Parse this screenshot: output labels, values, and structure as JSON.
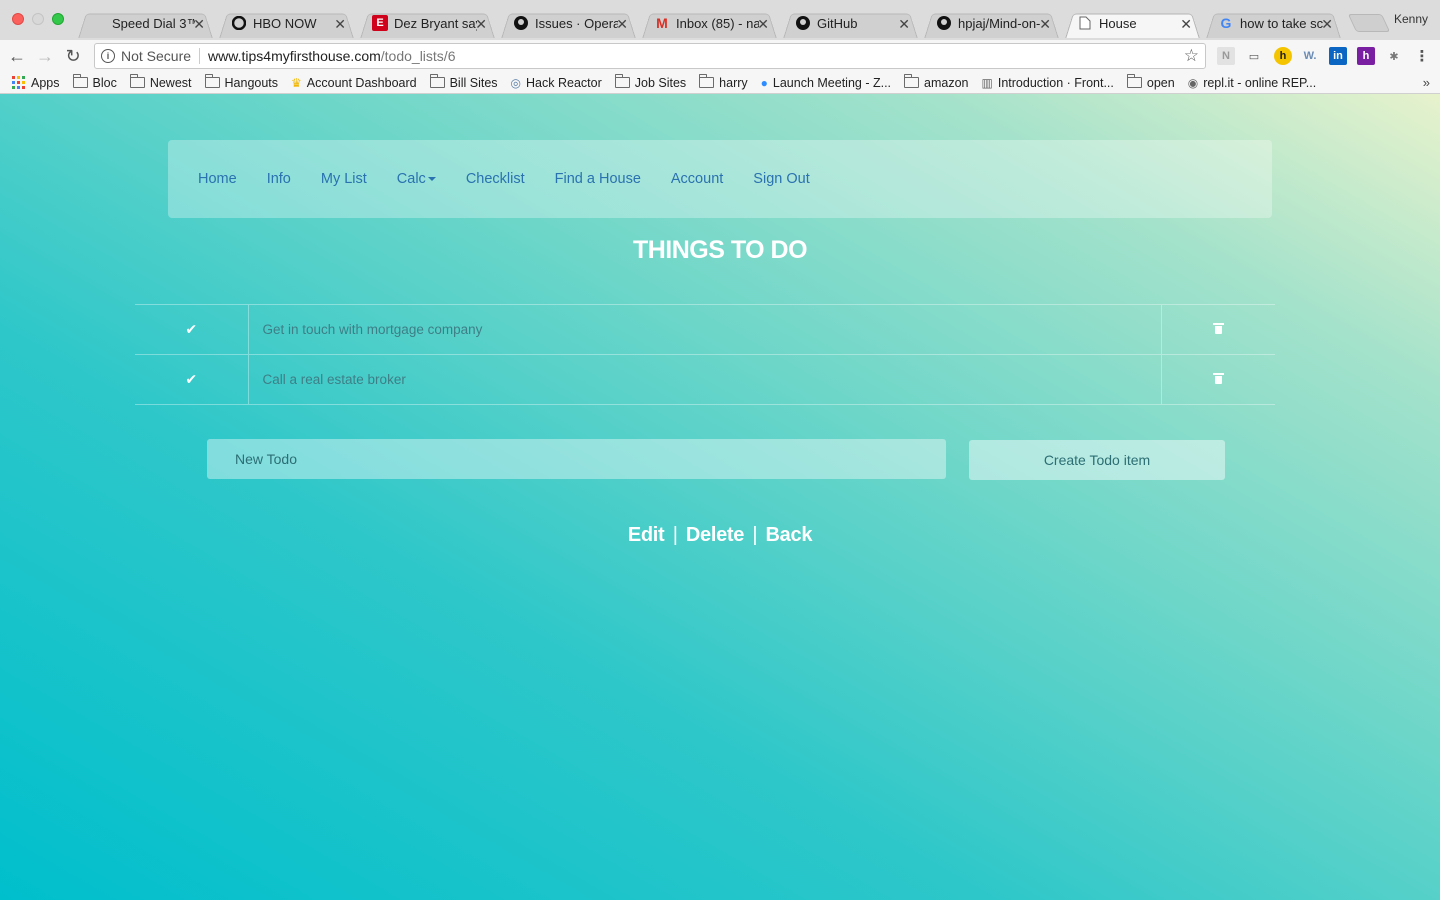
{
  "browser": {
    "tabs": [
      {
        "title": "Speed Dial 3™",
        "icon": "speed-dial-icon"
      },
      {
        "title": "HBO NOW",
        "icon": "hbo-icon"
      },
      {
        "title": "Dez Bryant say",
        "icon": "espn-icon"
      },
      {
        "title": "Issues · Operat",
        "icon": "github-icon"
      },
      {
        "title": "Inbox (85) - na",
        "icon": "gmail-icon"
      },
      {
        "title": "GitHub",
        "icon": "github-icon"
      },
      {
        "title": "hpjaj/Mind-on-",
        "icon": "github-icon"
      },
      {
        "title": "House",
        "icon": "page-icon",
        "active": true
      },
      {
        "title": "how to take scr",
        "icon": "google-icon"
      }
    ],
    "profile_name": "Kenny",
    "security_label": "Not Secure",
    "url_host": "www.tips4myfirsthouse.com",
    "url_path": "/todo_lists/6",
    "bookmarks": [
      {
        "label": "Apps",
        "icon": "apps-grid-icon"
      },
      {
        "label": "Bloc",
        "icon": "folder-icon"
      },
      {
        "label": "Newest",
        "icon": "folder-icon"
      },
      {
        "label": "Hangouts",
        "icon": "folder-icon"
      },
      {
        "label": "Account Dashboard",
        "icon": "crown-icon"
      },
      {
        "label": "Bill Sites",
        "icon": "folder-icon"
      },
      {
        "label": "Hack Reactor",
        "icon": "hack-reactor-icon"
      },
      {
        "label": "Job Sites",
        "icon": "folder-icon"
      },
      {
        "label": "harry",
        "icon": "folder-icon"
      },
      {
        "label": "Launch Meeting - Z...",
        "icon": "zoom-icon"
      },
      {
        "label": "amazon",
        "icon": "folder-icon"
      },
      {
        "label": "Introduction · Front...",
        "icon": "book-icon"
      },
      {
        "label": "open",
        "icon": "folder-icon"
      },
      {
        "label": "repl.it - online REP...",
        "icon": "replit-icon"
      }
    ]
  },
  "nav": {
    "items": [
      "Home",
      "Info",
      "My List",
      "Calc",
      "Checklist",
      "Find a House",
      "Account",
      "Sign Out"
    ]
  },
  "page": {
    "title": "THINGS TO DO",
    "todos": [
      {
        "text": "Get in touch with mortgage company"
      },
      {
        "text": "Call a real estate broker"
      }
    ],
    "new_todo_placeholder": "New Todo",
    "create_button": "Create Todo item",
    "footer": {
      "edit": "Edit",
      "delete": "Delete",
      "back": "Back",
      "separator": "|"
    }
  },
  "colors": {
    "gradient_start": "#00bfcc",
    "gradient_end": "#e7f2cc",
    "nav_link": "#2a72b0",
    "todo_text": "#3e7f87"
  }
}
